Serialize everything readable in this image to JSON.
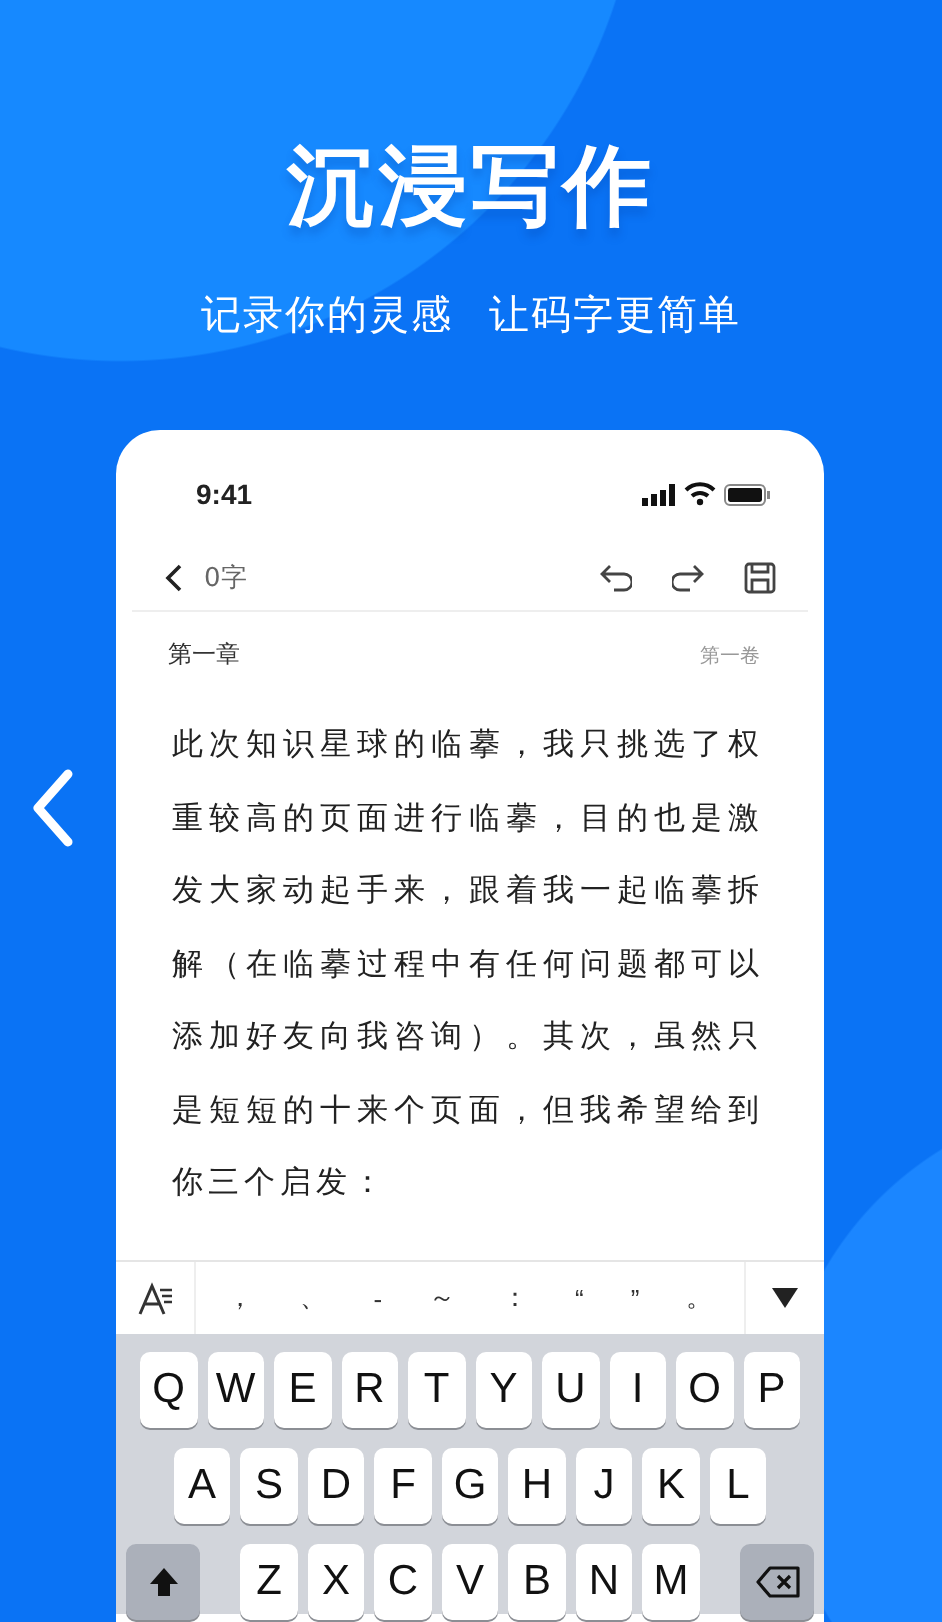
{
  "headline": "沉浸写作",
  "subtitle": [
    "记录你的灵感",
    "让码字更简单"
  ],
  "phone": {
    "status_time": "9:41",
    "editor": {
      "word_count": "0字",
      "chapter": "第一章",
      "volume": "第一卷",
      "body_lines": [
        "此次知识星球的临摹，我只挑选了权",
        "重较高的页面进行临摹，目的也是激",
        "发大家动起手来，跟着我一起临摹拆",
        "解（在临摹过程中有任何问题都可以",
        "添加好友向我咨询）。其次，虽然只",
        "是短短的十来个页面，但我希望给到",
        "你三个启发："
      ]
    },
    "toolbar_symbols": [
      "，",
      "、",
      "-",
      "～",
      "：",
      "“",
      "”",
      "。"
    ],
    "keyboard_rows": [
      [
        "Q",
        "W",
        "E",
        "R",
        "T",
        "Y",
        "U",
        "I",
        "O",
        "P"
      ],
      [
        "A",
        "S",
        "D",
        "F",
        "G",
        "H",
        "J",
        "K",
        "L"
      ],
      [
        "Z",
        "X",
        "C",
        "V",
        "B",
        "N",
        "M"
      ]
    ]
  }
}
